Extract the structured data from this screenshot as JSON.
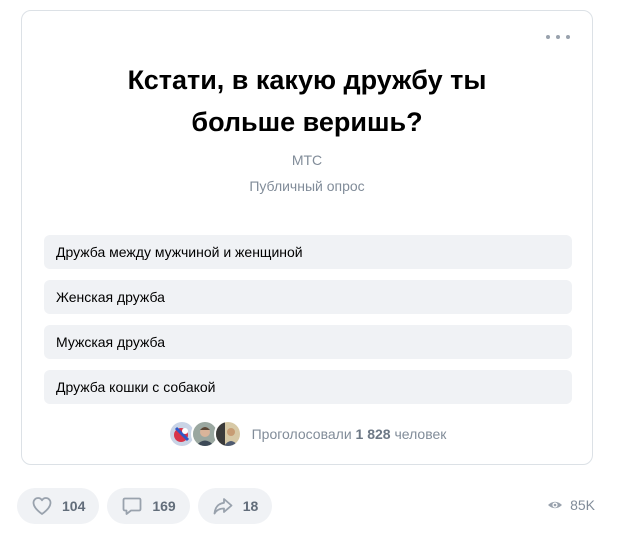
{
  "poll": {
    "title": "Кстати, в какую дружбу ты больше веришь?",
    "author": "МТС",
    "type": "Публичный опрос",
    "options": [
      {
        "label": "Дружба между мужчиной и женщиной"
      },
      {
        "label": "Женская дружба"
      },
      {
        "label": "Мужская дружба"
      },
      {
        "label": "Дружба кошки с собакой"
      }
    ],
    "voters": {
      "prefix": "Проголосовали",
      "count": "1 828",
      "suffix": "человек"
    }
  },
  "actions": {
    "likes": "104",
    "comments": "169",
    "shares": "18",
    "views": "85K"
  },
  "icons": {
    "more": "more-horizontal-icon",
    "like": "heart-icon",
    "comment": "comment-icon",
    "share": "share-arrow-icon",
    "views": "eye-icon"
  },
  "colors": {
    "option_bg": "#f0f2f5",
    "secondary_text": "#818c99",
    "border": "#dce1e6"
  }
}
